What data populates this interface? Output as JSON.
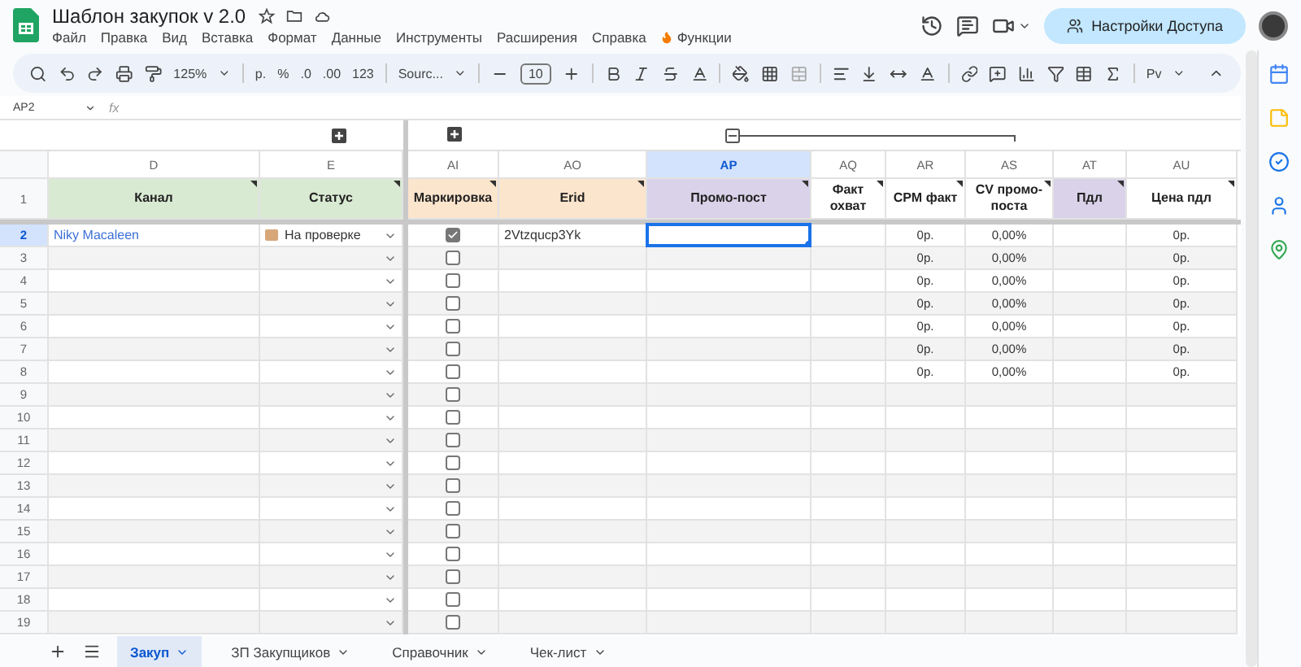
{
  "window": {
    "title": "Шаблон закупок v 2.0"
  },
  "menu": [
    {
      "label": "Файл"
    },
    {
      "label": "Правка"
    },
    {
      "label": "Вид"
    },
    {
      "label": "Вставка"
    },
    {
      "label": "Формат"
    },
    {
      "label": "Данные"
    },
    {
      "label": "Инструменты"
    },
    {
      "label": "Расширения"
    },
    {
      "label": "Справка"
    },
    {
      "label": "Функции",
      "kind": "fire"
    }
  ],
  "share_button": "Настройки Доступа",
  "toolbar": {
    "zoom": "125%",
    "currency": "р.",
    "percent": "%",
    "dec_less": ".0",
    "dec_more": ".00",
    "number_format": "123",
    "font": "Sourc...",
    "font_size": "10",
    "input_tools": "Pv"
  },
  "formula_bar": {
    "cell": "AP2",
    "fx": "fx"
  },
  "columns": [
    {
      "letter": "D",
      "title": "Канал",
      "color": "#d9ead3",
      "kind": "link",
      "selected": false
    },
    {
      "letter": "E",
      "title": "Статус",
      "color": "#d9ead3",
      "kind": "status",
      "selected": false
    },
    {
      "letter": "AI",
      "title": "Маркировка",
      "color": "#fce5cd",
      "kind": "checkbox",
      "selected": false
    },
    {
      "letter": "AO",
      "title": "Erid",
      "color": "#fce5cd",
      "kind": "text",
      "selected": false
    },
    {
      "letter": "AP",
      "title": "Промо-пост",
      "color": "#d9d2e9",
      "kind": "text",
      "selected": true
    },
    {
      "letter": "AQ",
      "title": "Факт охват",
      "color": "#ffffff",
      "kind": "text",
      "selected": false
    },
    {
      "letter": "AR",
      "title": "CPM факт",
      "color": "#ffffff",
      "kind": "number",
      "selected": false
    },
    {
      "letter": "AS",
      "title": "CV промо-поста",
      "color": "#ffffff",
      "kind": "number",
      "selected": false
    },
    {
      "letter": "AT",
      "title": "Пдл",
      "color": "#d9d2e9",
      "kind": "text",
      "selected": false
    },
    {
      "letter": "AU",
      "title": "Цена пдл",
      "color": "#ffffff",
      "kind": "number",
      "selected": false
    }
  ],
  "header_row": "1",
  "rows": [
    {
      "number": "2",
      "selected": true,
      "cells": [
        "Niky Macaleen",
        "На проверке",
        true,
        "2Vtzqucp3Yk",
        null,
        null,
        "0р.",
        "0,00%",
        null,
        "0р."
      ]
    },
    {
      "number": "3",
      "selected": false,
      "cells": [
        null,
        null,
        false,
        null,
        null,
        null,
        "0р.",
        "0,00%",
        null,
        "0р."
      ]
    },
    {
      "number": "4",
      "selected": false,
      "cells": [
        null,
        null,
        false,
        null,
        null,
        null,
        "0р.",
        "0,00%",
        null,
        "0р."
      ]
    },
    {
      "number": "5",
      "selected": false,
      "cells": [
        null,
        null,
        false,
        null,
        null,
        null,
        "0р.",
        "0,00%",
        null,
        "0р."
      ]
    },
    {
      "number": "6",
      "selected": false,
      "cells": [
        null,
        null,
        false,
        null,
        null,
        null,
        "0р.",
        "0,00%",
        null,
        "0р."
      ]
    },
    {
      "number": "7",
      "selected": false,
      "cells": [
        null,
        null,
        false,
        null,
        null,
        null,
        "0р.",
        "0,00%",
        null,
        "0р."
      ]
    },
    {
      "number": "8",
      "selected": false,
      "cells": [
        null,
        null,
        false,
        null,
        null,
        null,
        "0р.",
        "0,00%",
        null,
        "0р."
      ]
    },
    {
      "number": "9",
      "selected": false,
      "cells": [
        null,
        null,
        false,
        null,
        null,
        null,
        null,
        null,
        null,
        null
      ]
    },
    {
      "number": "10",
      "selected": false,
      "cells": [
        null,
        null,
        false,
        null,
        null,
        null,
        null,
        null,
        null,
        null
      ]
    },
    {
      "number": "11",
      "selected": false,
      "cells": [
        null,
        null,
        false,
        null,
        null,
        null,
        null,
        null,
        null,
        null
      ]
    },
    {
      "number": "12",
      "selected": false,
      "cells": [
        null,
        null,
        false,
        null,
        null,
        null,
        null,
        null,
        null,
        null
      ]
    },
    {
      "number": "13",
      "selected": false,
      "cells": [
        null,
        null,
        false,
        null,
        null,
        null,
        null,
        null,
        null,
        null
      ]
    },
    {
      "number": "14",
      "selected": false,
      "cells": [
        null,
        null,
        false,
        null,
        null,
        null,
        null,
        null,
        null,
        null
      ]
    },
    {
      "number": "15",
      "selected": false,
      "cells": [
        null,
        null,
        false,
        null,
        null,
        null,
        null,
        null,
        null,
        null
      ]
    },
    {
      "number": "16",
      "selected": false,
      "cells": [
        null,
        null,
        false,
        null,
        null,
        null,
        null,
        null,
        null,
        null
      ]
    },
    {
      "number": "17",
      "selected": false,
      "cells": [
        null,
        null,
        false,
        null,
        null,
        null,
        null,
        null,
        null,
        null
      ]
    },
    {
      "number": "18",
      "selected": false,
      "cells": [
        null,
        null,
        false,
        null,
        null,
        null,
        null,
        null,
        null,
        null
      ]
    },
    {
      "number": "19",
      "selected": false,
      "cells": [
        null,
        null,
        false,
        null,
        null,
        null,
        null,
        null,
        null,
        null
      ]
    }
  ],
  "sheet_tabs": [
    {
      "label": "Закуп",
      "selected": true
    },
    {
      "label": "ЗП Закупщиков",
      "selected": false
    },
    {
      "label": "Справочник",
      "selected": false
    },
    {
      "label": "Чек-лист",
      "selected": false
    }
  ]
}
